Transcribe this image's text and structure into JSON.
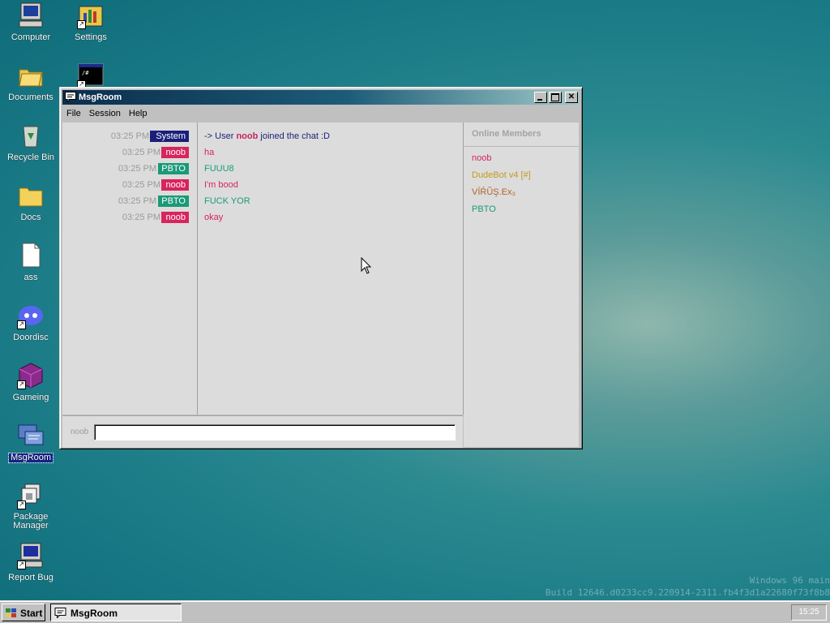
{
  "desktop": {
    "icons": [
      {
        "label": "Computer",
        "icon": "computer-icon"
      },
      {
        "label": "Settings",
        "icon": "settings-icon"
      },
      {
        "label": "Documents",
        "icon": "folder-open-icon"
      },
      {
        "label": "Recycle Bin",
        "icon": "recycle-bin-icon"
      },
      {
        "label": "Docs",
        "icon": "folder-icon"
      },
      {
        "label": "ass",
        "icon": "file-icon"
      },
      {
        "label": "Doordisc",
        "icon": "discord-icon"
      },
      {
        "label": "Gameing",
        "icon": "cube-icon"
      },
      {
        "label": "MsgRoom",
        "icon": "msgroom-icon"
      },
      {
        "label": "Package Manager",
        "icon": "package-icon"
      },
      {
        "label": "Report Bug",
        "icon": "monitor-icon"
      },
      {
        "label": "",
        "icon": "terminal-icon"
      }
    ],
    "watermark": {
      "line1": "Windows 96 main",
      "line2": "Build 12646.d0233cc9.220914-2311.fb4f3d1a22680f73f8b8"
    }
  },
  "window": {
    "title": "MsgRoom",
    "menu": [
      "File",
      "Session",
      "Help"
    ],
    "messages": [
      {
        "time": "03:25 PM",
        "user": "System",
        "badge_color": "#1a1f7a",
        "text_prefix": "-> User ",
        "text_bold": "noob",
        "text_suffix": " joined the chat :D",
        "text_color": "#1a1f7a",
        "bold_color": "#c8245e"
      },
      {
        "time": "03:25 PM",
        "user": "noob",
        "badge_color": "#d8245e",
        "text": "ha",
        "text_color": "#d8245e"
      },
      {
        "time": "03:25 PM",
        "user": "PBTO",
        "badge_color": "#1a9a78",
        "text": "FUUU8",
        "text_color": "#1a9a78"
      },
      {
        "time": "03:25 PM",
        "user": "noob",
        "badge_color": "#d8245e",
        "text": "I'm bood",
        "text_color": "#d8245e"
      },
      {
        "time": "03:25 PM",
        "user": "PBTO",
        "badge_color": "#1a9a78",
        "text": "FUCK YOR",
        "text_color": "#1a9a78"
      },
      {
        "time": "03:25 PM",
        "user": "noob",
        "badge_color": "#d8245e",
        "text": "okay",
        "text_color": "#d8245e"
      }
    ],
    "members_title": "Online Members",
    "members": [
      {
        "name": "noob",
        "color": "#d8245e"
      },
      {
        "name": "DudeBot v4 [#]",
        "color": "#c29a1e"
      },
      {
        "name": "VÍŔŨŞ.Ex₃",
        "color": "#b0622a"
      },
      {
        "name": "PBTO",
        "color": "#1a9a78"
      }
    ],
    "nick_label": "noob",
    "input_value": ""
  },
  "taskbar": {
    "start_label": "Start",
    "task_label": "MsgRoom",
    "clock": "15:25"
  }
}
